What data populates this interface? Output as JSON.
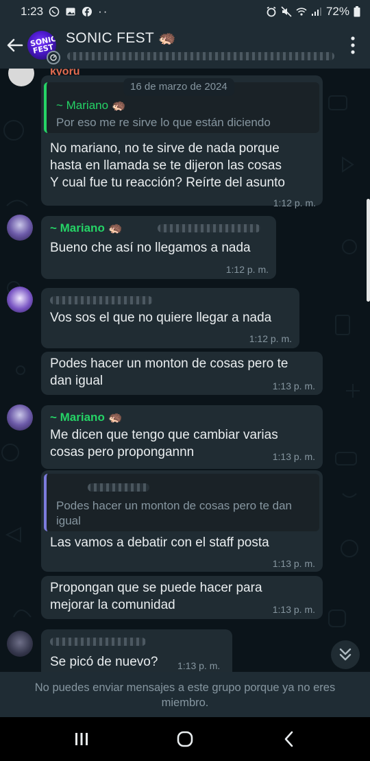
{
  "status_bar": {
    "time": "1:23",
    "battery": "72%"
  },
  "header": {
    "title": "SONIC FEST 🦔",
    "avatar_text": "SONIC FEST"
  },
  "chat": {
    "date_label": "16 de marzo de 2024",
    "messages": [
      {
        "sender_partial": "kyoru",
        "quote_name": "~ Mariano 🦔",
        "quote_text": "Por eso me re sirve lo que están diciendo",
        "text_line1": "No mariano, no te sirve de nada porque",
        "text_line2": "hasta en llamada se te dijeron las cosas",
        "text_line3": "Y cual fue tu reacción? Reírte del asunto",
        "time": "1:12 p. m."
      },
      {
        "sender": "~ Mariano 🦔",
        "text": "Bueno che así no llegamos a nada",
        "time": "1:12 p. m."
      },
      {
        "text": "Vos sos el que no quiere llegar a nada",
        "time": "1:12 p. m."
      },
      {
        "text_line1": "Podes hacer un monton de cosas pero te",
        "text_line2": "dan igual",
        "time": "1:13 p. m."
      },
      {
        "sender": "~ Mariano 🦔",
        "text_line1": "Me dicen que tengo que cambiar varias",
        "text_line2": "cosas pero propongannn",
        "time": "1:13 p. m."
      },
      {
        "quote_text_line1": "Podes hacer un monton de cosas pero te dan",
        "quote_text_line2": "igual",
        "text": "Las vamos a debatir con el staff posta",
        "time": "1:13 p. m."
      },
      {
        "text_line1": "Propongan que se puede hacer para",
        "text_line2": "mejorar la comunidad",
        "time": "1:13 p. m."
      },
      {
        "text": "Se picó de nuevo?",
        "time": "1:13 p. m."
      }
    ]
  },
  "footer": {
    "notice_line1": "No puedes enviar mensajes a este grupo porque ya no eres",
    "notice_line2": "miembro."
  },
  "colors": {
    "background": "#0b141a",
    "bar": "#1f2c34",
    "bubble": "#202c33",
    "accent_green": "#25d366",
    "muted": "#8696a0"
  },
  "icons": [
    "whatsapp-icon",
    "gallery-icon",
    "facebook-icon",
    "alarm-icon",
    "mute-icon",
    "wifi-icon",
    "signal-icon",
    "battery-icon",
    "back-arrow-icon",
    "more-vert-icon",
    "scroll-down-icon",
    "recents-icon",
    "home-icon",
    "nav-back-icon"
  ]
}
